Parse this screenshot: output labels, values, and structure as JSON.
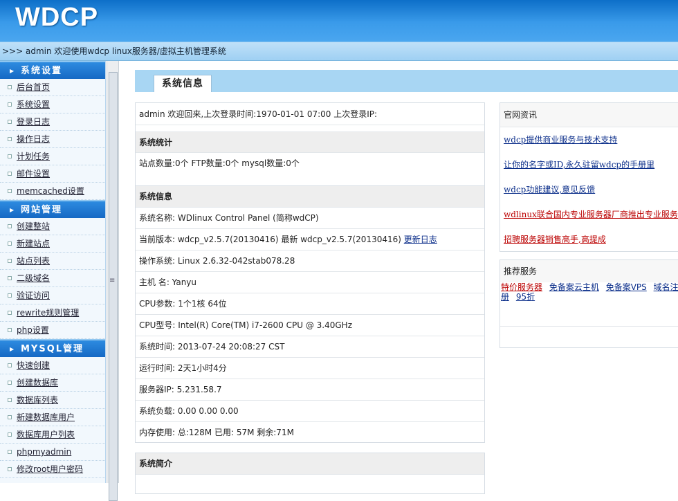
{
  "header": {
    "logo": "WDCP"
  },
  "subbar": {
    "text": ">>> admin 欢迎使用wdcp linux服务器/虚拟主机管理系统"
  },
  "sidebar": {
    "sections": [
      {
        "title": "系统设置",
        "items": [
          "后台首页",
          "系统设置",
          "登录日志",
          "操作日志",
          "计划任务",
          "邮件设置",
          "memcached设置"
        ]
      },
      {
        "title": "网站管理",
        "items": [
          "创建整站",
          "新建站点",
          "站点列表",
          "二级域名",
          "验证访问",
          "rewrite规则管理",
          "php设置"
        ]
      },
      {
        "title": "MYSQL管理",
        "items": [
          "快速创建",
          "创建数据库",
          "数据库列表",
          "新建数据库用户",
          "数据库用户列表",
          "phpmyadmin",
          "修改root用户密码"
        ]
      }
    ]
  },
  "main": {
    "tab": "系统信息",
    "welcome": "admin 欢迎回来,上次登录时间:1970-01-01 07:00 上次登录IP:",
    "stats": {
      "title": "系统统计",
      "text": "站点数量:0个  FTP数量:0个  mysql数量:0个"
    },
    "sysinfo": {
      "title": "系统信息",
      "name": "系统名称: WDlinux Control Panel (简称wdCP)",
      "version": "当前版本: wdcp_v2.5.7(20130416) 最新 wdcp_v2.5.7(20130416)",
      "changelog": "更新日志",
      "os": "操作系统: Linux 2.6.32-042stab078.28",
      "host": "主机 名: Yanyu",
      "cpu": "CPU参数: 1个1核 64位",
      "cpu_model": "CPU型号:  Intel(R) Core(TM) i7-2600 CPU @ 3.40GHz",
      "time": "系统时间: 2013-07-24 20:08:27 CST",
      "uptime": "运行时间: 2天1小时4分",
      "ip": "服务器IP: 5.231.58.7",
      "load": "系统负载: 0.00   0.00   0.00",
      "memory": "内存使用: 总:128M   已用: 57M   剩余:71M"
    },
    "intro": {
      "title": "系统简介"
    }
  },
  "news": {
    "title": "官网资讯",
    "items": [
      {
        "text": "wdcp提供商业服务与技术支持",
        "color": "#0b2e8a"
      },
      {
        "text": "让你的名字或ID,永久驻留wdcp的手册里",
        "color": "#0b2e8a"
      },
      {
        "text": "wdcp功能建议,意见反馈",
        "color": "#0b2e8a"
      },
      {
        "text": "wdlinux联合国内专业服务器厂商推出专业服务器",
        "color": "#bb0000"
      },
      {
        "text": "招聘服务器销售高手,高提成",
        "color": "#bb0000"
      }
    ]
  },
  "services": {
    "title": "推荐服务",
    "links": [
      "特价服务器",
      "免备案云主机",
      "免备案VPS",
      "域名注册",
      "95折"
    ]
  }
}
